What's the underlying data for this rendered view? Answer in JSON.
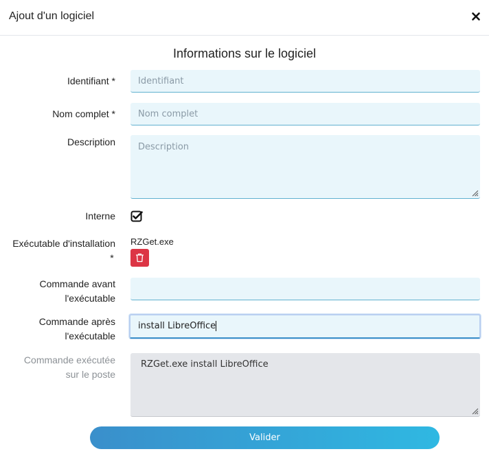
{
  "modal": {
    "title": "Ajout d'un logiciel",
    "close_icon": "close-icon"
  },
  "section": {
    "title": "Informations sur le logiciel"
  },
  "form": {
    "identifiant": {
      "label": "Identifiant *",
      "placeholder": "Identifiant",
      "value": ""
    },
    "nom_complet": {
      "label": "Nom complet *",
      "placeholder": "Nom complet",
      "value": ""
    },
    "description": {
      "label": "Description",
      "placeholder": "Description",
      "value": ""
    },
    "interne": {
      "label": "Interne",
      "checked": true
    },
    "executable": {
      "label_line1": "Exécutable d'installation",
      "label_line2": "*",
      "file_name": "RZGet.exe",
      "delete_icon": "trash-icon"
    },
    "commande_avant": {
      "label_line1": "Commande avant",
      "label_line2": "l'exécutable",
      "value": ""
    },
    "commande_apres": {
      "label_line1": "Commande après",
      "label_line2": "l'exécutable",
      "value": "install LibreOffice"
    },
    "commande_executee": {
      "label_line1": "Commande exécutée",
      "label_line2": "sur le poste",
      "value": "RZGet.exe install LibreOffice"
    }
  },
  "actions": {
    "submit_label": "Valider"
  },
  "colors": {
    "danger": "#dc3545",
    "input_bg": "#e9f6fb",
    "readonly_bg": "#e4e6ea",
    "button_gradient_start": "#3a8fcb",
    "button_gradient_end": "#2fb8e2"
  }
}
